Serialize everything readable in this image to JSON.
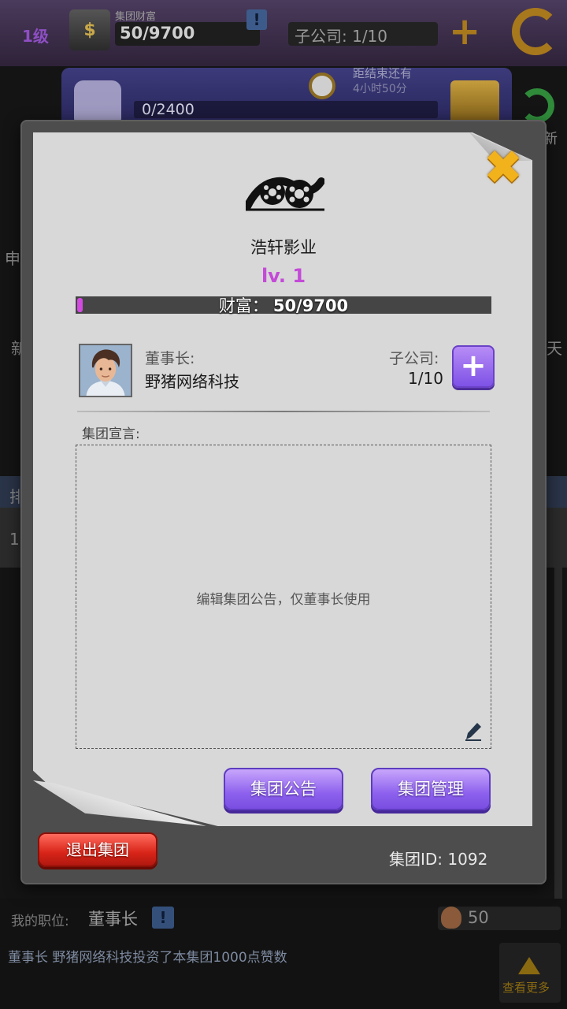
{
  "background": {
    "top_bar": {
      "level": "1级",
      "wealth_title": "集团财富",
      "wealth_value": "50/9700",
      "alert_icon_text": "!",
      "subsidiary_label": "子公司: 1/10"
    },
    "banner": {
      "progress_text": "0/2400",
      "deadline_label": "距结束还有",
      "deadline_time": "4小时50分",
      "refresh_label": "新"
    },
    "side_labels": [
      "申",
      "新",
      "天",
      "排",
      "1"
    ],
    "bottom": {
      "position_label": "我的职位:",
      "position_value": "董事长",
      "likes_value": "50",
      "message": "董事长 野猪网络科技投资了本集团1000点赞数",
      "more_label": "查看更多"
    }
  },
  "dialog": {
    "close_glyph": "✖",
    "group_name": "浩轩影业",
    "level": "lv. 1",
    "wealth": {
      "label": "财富：",
      "value": "50/9700",
      "current": 50,
      "max": 9700
    },
    "chairman": {
      "label": "董事长:",
      "name": "野猪网络科技"
    },
    "subsidiary": {
      "label": "子公司:",
      "count": "1/10",
      "add_glyph": "+"
    },
    "manifesto": {
      "label": "集团宣言:",
      "placeholder": "编辑集团公告，仅董事长使用"
    },
    "buttons": {
      "announce": "集团公告",
      "manage": "集团管理",
      "leave": "退出集团"
    },
    "group_id": "集团ID:  1092"
  },
  "colors": {
    "level_purple": "#c44ad8",
    "button_purple": "#8e62ee",
    "leave_red": "#d82418",
    "close_gold": "#f2b21c",
    "paper": "#d8d8d8"
  },
  "icons": [
    "film-reel-logo-icon",
    "close-x-icon",
    "avatar-portrait",
    "plus-icon",
    "pencil-edit-icon",
    "thumbs-up-icon",
    "clock-icon",
    "gift-icon",
    "refresh-icon",
    "back-arrow-icon",
    "exclamation-icon",
    "money-bag-icon",
    "up-triangle-icon"
  ]
}
